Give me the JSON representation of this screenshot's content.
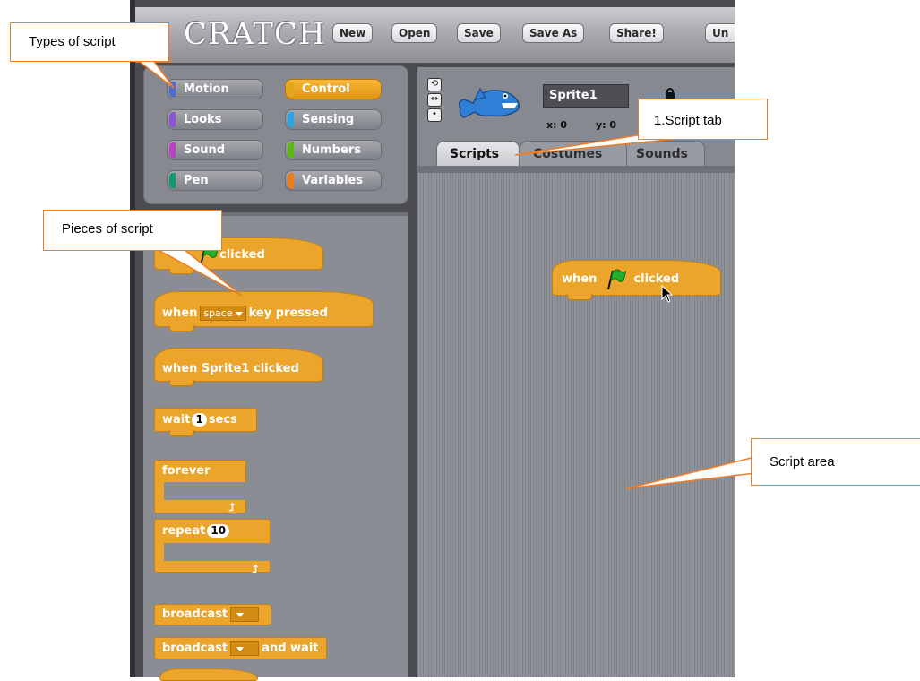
{
  "toolbar": {
    "logo": "CRATCH",
    "buttons": [
      "New",
      "Open",
      "Save",
      "Save As",
      "Share!",
      "Un"
    ]
  },
  "categories": [
    {
      "label": "Motion",
      "color": "#4a6cd4",
      "active": false
    },
    {
      "label": "Control",
      "color": "#e1a91a",
      "active": true
    },
    {
      "label": "Looks",
      "color": "#8a55d7",
      "active": false
    },
    {
      "label": "Sensing",
      "color": "#2ca5e2",
      "active": false
    },
    {
      "label": "Sound",
      "color": "#bb42c3",
      "active": false
    },
    {
      "label": "Numbers",
      "color": "#5cb712",
      "active": false
    },
    {
      "label": "Pen",
      "color": "#0e9a6c",
      "active": false
    },
    {
      "label": "Variables",
      "color": "#ee7d16",
      "active": false
    }
  ],
  "blocks": {
    "when_flag": "clicked",
    "when_key_prefix": "when",
    "when_key_value": "space",
    "when_key_suffix": "key pressed",
    "when_sprite": "when Sprite1 clicked",
    "wait_prefix": "wait",
    "wait_value": "1",
    "wait_suffix": "secs",
    "forever": "forever",
    "repeat_prefix": "repeat",
    "repeat_value": "10",
    "broadcast": "broadcast",
    "broadcast_wait": "broadcast",
    "broadcast_wait_suffix": "and wait"
  },
  "sprite": {
    "name": "Sprite1",
    "x_label": "x:",
    "x_value": "0",
    "y_label": "y:",
    "y_value": "0"
  },
  "tabs": [
    "Scripts",
    "Costumes",
    "Sounds"
  ],
  "script_block": {
    "prefix": "when",
    "suffix": "clicked"
  },
  "callouts": {
    "types": "Types of script",
    "pieces": "Pieces of script",
    "script_tab": "1.Script tab",
    "script_area": "Script area"
  },
  "colors": {
    "control": "#eaa52a",
    "callout_border": "#ef7c26",
    "flag": "#1fa02a"
  }
}
